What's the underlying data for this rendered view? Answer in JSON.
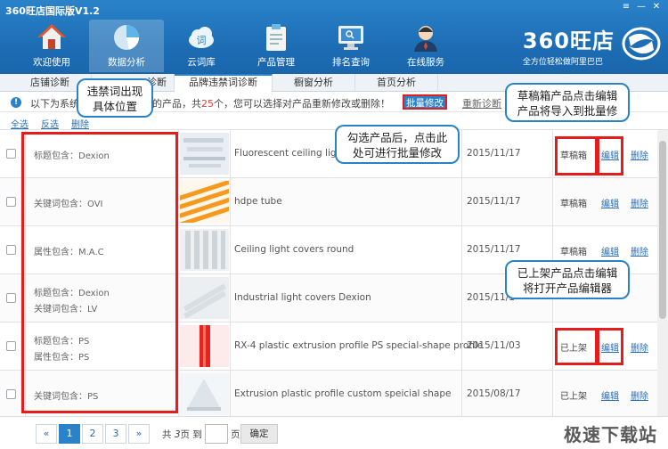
{
  "window": {
    "title": "360旺店国际版V1.2",
    "controls": [
      "≡",
      "—",
      "✕"
    ]
  },
  "brand": {
    "name": "360旺店",
    "tagline": "全方位轻松做阿里巴巴"
  },
  "nav": [
    {
      "label": "欢迎使用",
      "icon": "home-icon"
    },
    {
      "label": "数据分析",
      "icon": "pie-chart-icon"
    },
    {
      "label": "云词库",
      "icon": "cloud-icon"
    },
    {
      "label": "产品管理",
      "icon": "clipboard-icon"
    },
    {
      "label": "排名查询",
      "icon": "monitor-icon"
    },
    {
      "label": "在线服务",
      "icon": "support-agent-icon"
    }
  ],
  "tabs": [
    "店铺诊断",
    "诊断",
    "品牌违禁词诊断",
    "橱窗分析",
    "首页分析"
  ],
  "info": {
    "prefix": "以下为系统",
    "middle": "禁词的产品，共",
    "count": "25",
    "suffix": "个，您可以选择对产品重新修改或删除！",
    "batch_button": "批量修改",
    "refresh_link": "重新诊断"
  },
  "toolbar": {
    "select_all": "全选",
    "invert": "反选",
    "delete": "删除"
  },
  "rows": [
    {
      "kw1": "标题包含：Dexion",
      "kw2": "",
      "name": "Fluorescent ceiling light p",
      "date": "2015/11/17",
      "status": "草稿箱",
      "edit": "编辑",
      "del": "删除"
    },
    {
      "kw1": "关键词包含：OVI",
      "kw2": "",
      "name": "hdpe tube",
      "date": "2015/11/17",
      "status": "草稿箱",
      "edit": "编辑",
      "del": "删除"
    },
    {
      "kw1": "属性包含：M.A.C",
      "kw2": "",
      "name": "Ceiling light covers round",
      "date": "2015/11/17",
      "status": "草稿箱",
      "edit": "编辑",
      "del": "删除"
    },
    {
      "kw1": "标题包含：Dexion",
      "kw2": "关键词包含：LV",
      "name": "Industrial light covers Dexion",
      "date": "2015/11/1",
      "status": "",
      "edit": "",
      "del": ""
    },
    {
      "kw1": "标题包含：PS",
      "kw2": "属性包含：PS",
      "name": "RX-4 plastic extrusion profile PS special-shape profile",
      "date": "2015/11/03",
      "status": "已上架",
      "edit": "编辑",
      "del": "删除"
    },
    {
      "kw1": "关键词包含：PS",
      "kw2": "",
      "name": "Extrusion plastic profile custom speicial shape",
      "date": "2015/08/17",
      "status": "已上架",
      "edit": "编辑",
      "del": "删除"
    }
  ],
  "pager": {
    "prev": "«",
    "pages": [
      "1",
      "2",
      "3"
    ],
    "next": "»",
    "total_prefix": "共",
    "total_pages": "3",
    "total_suffix": "页 到",
    "page_unit": "页",
    "go_button": "确定"
  },
  "callouts": {
    "left": "违禁词出现具体位置",
    "middle": "勾选产品后，点击此处可进行批量修改",
    "top_right": "草稿箱产品点击编辑产品将导入到批量修",
    "bottom_right": "已上架产品点击编辑将打开产品编辑器"
  },
  "watermark": "极速下载站",
  "colors": {
    "header_blue": "#1d6eb5",
    "annotation_red": "#e51c1c",
    "count_red": "#e03b3b"
  }
}
